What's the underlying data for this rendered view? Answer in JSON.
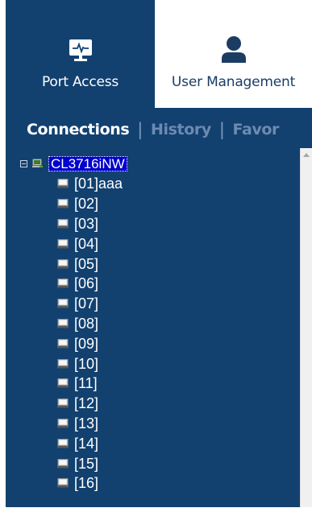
{
  "tabs": [
    {
      "label": "Port Access",
      "icon": "monitor-pulse-icon",
      "active": true
    },
    {
      "label": "User Management",
      "icon": "user-icon",
      "active": false
    }
  ],
  "subnav": {
    "connections": "Connections",
    "history": "History",
    "favorites": "Favor",
    "separator": "|"
  },
  "tree": {
    "root": "CL3716iNW",
    "ports": [
      "[01]aaa",
      "[02]",
      "[03]",
      "[04]",
      "[05]",
      "[06]",
      "[07]",
      "[08]",
      "[09]",
      "[10]",
      "[11]",
      "[12]",
      "[13]",
      "[14]",
      "[15]",
      "[16]"
    ]
  },
  "colors": {
    "navy": "#124170",
    "selection": "#0000cc",
    "dim_text": "#6e8ab0"
  }
}
